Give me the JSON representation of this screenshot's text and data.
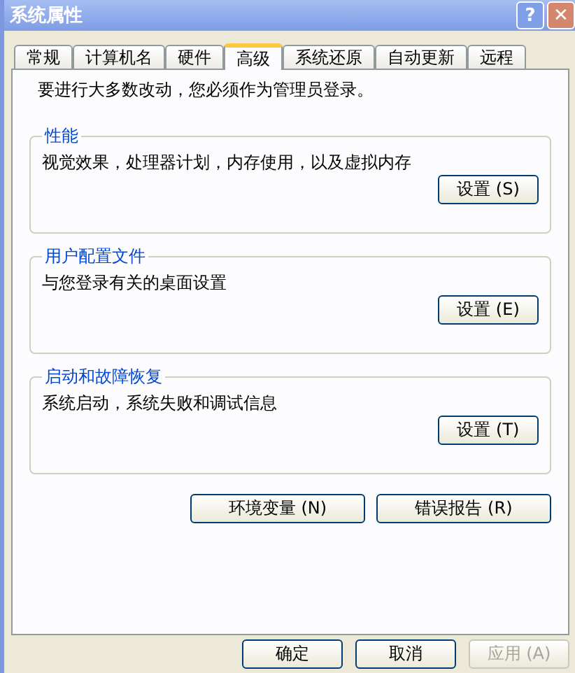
{
  "window": {
    "title": "系统属性",
    "controls": [
      {
        "kind": "help",
        "label": "?"
      },
      {
        "kind": "close",
        "label": "✕"
      }
    ]
  },
  "tabs": [
    {
      "label": "常规",
      "selected": false
    },
    {
      "label": "计算机名",
      "selected": false
    },
    {
      "label": "硬件",
      "selected": false
    },
    {
      "label": "高级",
      "selected": true
    },
    {
      "label": "系统还原",
      "selected": false
    },
    {
      "label": "自动更新",
      "selected": false
    },
    {
      "label": "远程",
      "selected": false
    }
  ],
  "notice": "要进行大多数改动，您必须作为管理员登录。",
  "groups": [
    {
      "title": "性能",
      "description": "视觉效果，处理器计划，内存使用，以及虚拟内存",
      "button": "设置 (S)"
    },
    {
      "title": "用户配置文件",
      "description": "与您登录有关的桌面设置",
      "button": "设置 (E)"
    },
    {
      "title": "启动和故障恢复",
      "description": "系统启动，系统失败和调试信息",
      "button": "设置 (T)"
    }
  ],
  "extra_buttons": [
    "环境变量 (N)",
    "错误报告 (R)"
  ],
  "dialog_buttons": [
    {
      "label": "确定",
      "disabled": false
    },
    {
      "label": "取消",
      "disabled": false
    },
    {
      "label": "应用 (A)",
      "disabled": true
    }
  ]
}
